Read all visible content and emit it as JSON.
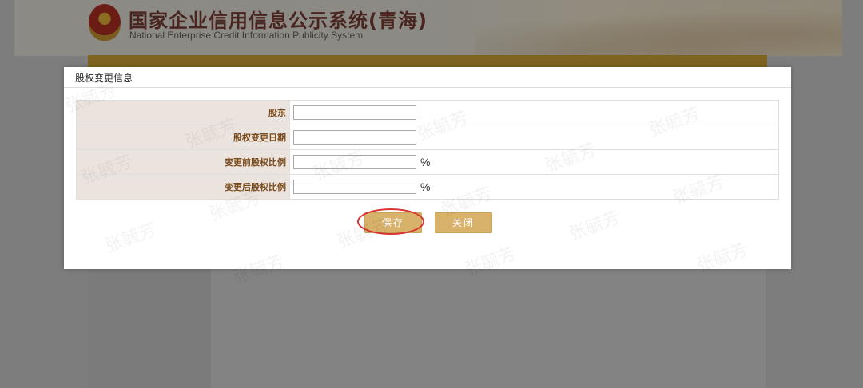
{
  "site": {
    "title": "国家企业信用信息公示系统(青海)",
    "subtitle": "National Enterprise Credit Information Publicity System"
  },
  "dialog": {
    "title": "股权变更信息",
    "fields": [
      {
        "label": "股东",
        "value": "",
        "unit": ""
      },
      {
        "label": "股权变更日期",
        "value": "",
        "unit": ""
      },
      {
        "label": "变更前股权比例",
        "value": "",
        "unit": "%"
      },
      {
        "label": "变更后股权比例",
        "value": "",
        "unit": "%"
      }
    ],
    "save_label": "保存",
    "close_label": "关闭"
  },
  "watermark": {
    "text": "张毓芳"
  },
  "colors": {
    "button": "#d8b26a",
    "label_bg": "#ebe3dd",
    "label_text": "#7a4a1a",
    "highlight": "#d9332f"
  }
}
